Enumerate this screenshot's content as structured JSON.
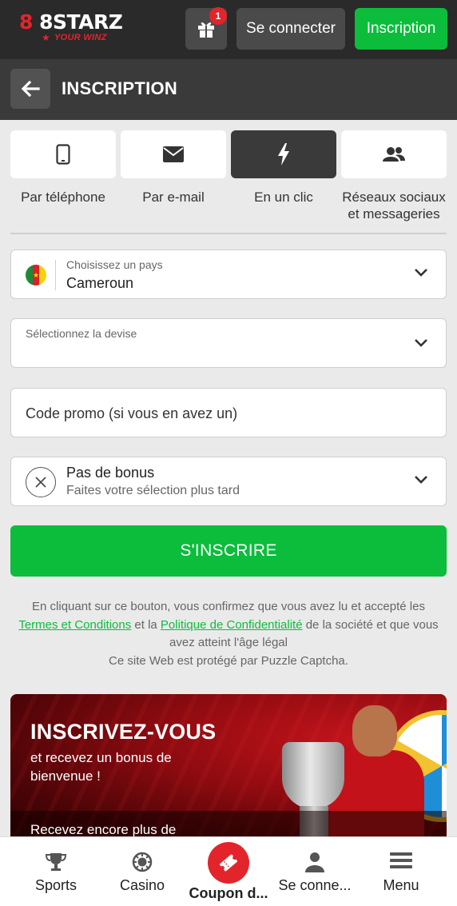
{
  "header": {
    "logo_main": "8 8STARZ",
    "logo_tagline": "YOUR WINZ",
    "gift_badge": "1",
    "login_label": "Se connecter",
    "register_label": "Inscription"
  },
  "titlebar": {
    "title": "INSCRIPTION"
  },
  "methods": [
    {
      "label": "Par téléphone",
      "icon": "phone-icon",
      "active": false
    },
    {
      "label": "Par e-mail",
      "icon": "envelope-icon",
      "active": false
    },
    {
      "label": "En un clic",
      "icon": "lightning-icon",
      "active": true
    },
    {
      "label": "Réseaux sociaux et messageries",
      "icon": "users-icon",
      "active": false
    }
  ],
  "form": {
    "country_label": "Choisissez un pays",
    "country_value": "Cameroun",
    "currency_label": "Sélectionnez la devise",
    "promo_placeholder": "Code promo (si vous en avez un)",
    "bonus_title": "Pas de bonus",
    "bonus_sub": "Faites votre sélection plus tard",
    "submit_label": "S'INSCRIRE"
  },
  "terms": {
    "part1": "En cliquant sur ce bouton, vous confirmez que vous avez lu et accepté les",
    "terms_link": "Termes et Conditions",
    "part2": "et la",
    "privacy_link": "Politique de Confidentialité",
    "part3": "de la société et que vous avez atteint l'âge légal",
    "captcha": "Ce site Web est protégé par Puzzle Captcha."
  },
  "banner": {
    "title": "INSCRIVEZ-VOUS",
    "subtitle": "et recevez un bonus de bienvenue !",
    "more": "Recevez encore plus de"
  },
  "bottom_nav": [
    {
      "label": "Sports",
      "icon": "trophy-icon"
    },
    {
      "label": "Casino",
      "icon": "casino-chip-icon"
    },
    {
      "label": "Coupon d...",
      "icon": "ticket-icon"
    },
    {
      "label": "Se conne...",
      "icon": "user-icon"
    },
    {
      "label": "Menu",
      "icon": "menu-icon"
    }
  ],
  "colors": {
    "brand_green": "#0bbd3b",
    "brand_red": "#e4242b",
    "header_bg": "#2a2a2a"
  }
}
